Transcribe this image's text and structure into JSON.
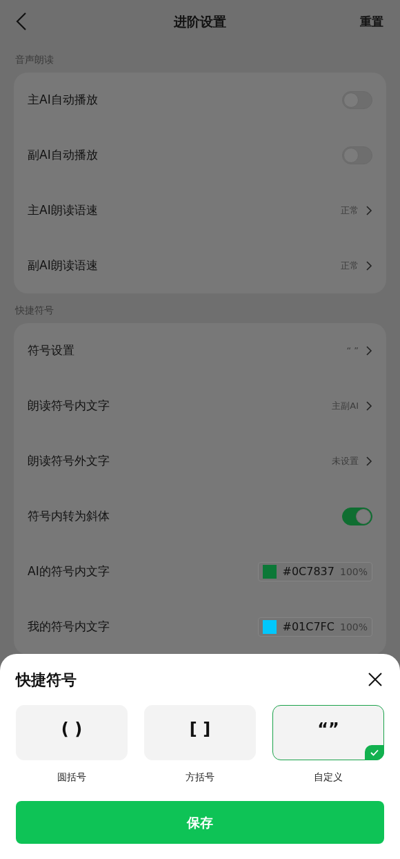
{
  "header": {
    "title": "进阶设置",
    "action": "重置"
  },
  "sections": [
    {
      "title": "音声朗读",
      "rows": [
        {
          "kind": "toggle",
          "label": "主AI自动播放",
          "on": false
        },
        {
          "kind": "toggle",
          "label": "副AI自动播放",
          "on": false
        },
        {
          "kind": "link",
          "label": "主AI朗读语速",
          "value": "正常"
        },
        {
          "kind": "link",
          "label": "副AI朗读语速",
          "value": "正常"
        }
      ]
    },
    {
      "title": "快捷符号",
      "rows": [
        {
          "kind": "link",
          "label": "符号设置",
          "value": "“ ”"
        },
        {
          "kind": "link",
          "label": "朗读符号内文字",
          "value": "主副AI"
        },
        {
          "kind": "link",
          "label": "朗读符号外文字",
          "value": "未设置"
        },
        {
          "kind": "toggle",
          "label": "符号内转为斜体",
          "on": true
        },
        {
          "kind": "color",
          "label": "AI的符号内文字",
          "value": "#0C7837",
          "opacity": "100%",
          "color": "#0c7837"
        },
        {
          "kind": "color",
          "label": "我的符号内文字",
          "value": "#01C7FC",
          "opacity": "100%",
          "color": "#01c7fc"
        }
      ]
    }
  ],
  "sheet": {
    "title": "快捷符号",
    "options": [
      {
        "symbol": "( )",
        "label": "圆括号",
        "selected": false
      },
      {
        "symbol": "[ ]",
        "label": "方括号",
        "selected": false
      },
      {
        "symbol": "“”",
        "label": "自定义",
        "selected": true
      }
    ],
    "save": "保存"
  }
}
